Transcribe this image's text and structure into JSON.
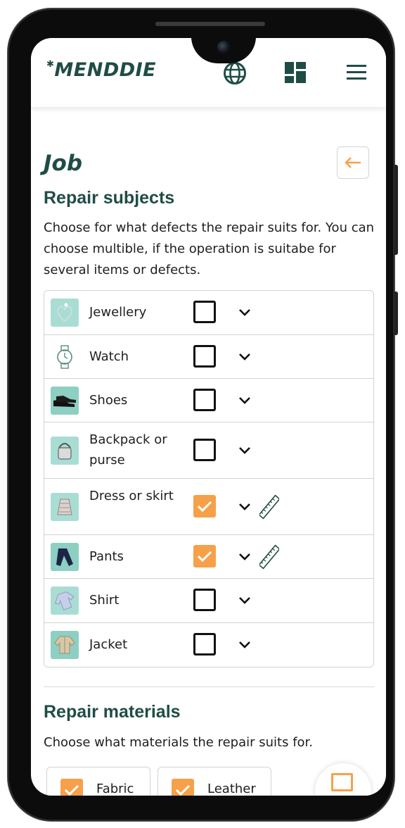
{
  "app": {
    "brand": "MENDDIE"
  },
  "header": {
    "icons": [
      "globe-icon",
      "dashboard-icon",
      "menu-icon"
    ]
  },
  "page": {
    "title": "Job"
  },
  "repair_subjects": {
    "title": "Repair subjects",
    "description": "Choose for what defects the repair suits for. You can choose multible, if the operation is suitabe for several items or defects.",
    "items": [
      {
        "label": "Jewellery",
        "checked": false,
        "has_measure": false
      },
      {
        "label": "Watch",
        "checked": false,
        "has_measure": false
      },
      {
        "label": "Shoes",
        "checked": false,
        "has_measure": false
      },
      {
        "label": "Backpack or purse",
        "checked": false,
        "has_measure": false
      },
      {
        "label": "Dress or skirt",
        "checked": true,
        "has_measure": true
      },
      {
        "label": "Pants",
        "checked": true,
        "has_measure": true
      },
      {
        "label": "Shirt",
        "checked": false,
        "has_measure": false
      },
      {
        "label": "Jacket",
        "checked": false,
        "has_measure": false
      }
    ]
  },
  "repair_materials": {
    "title": "Repair materials",
    "description": "Choose what materials the repair suits for.",
    "items": [
      {
        "label": "Fabric",
        "checked": true
      },
      {
        "label": "Leather",
        "checked": true
      }
    ]
  },
  "colors": {
    "brand": "#1f4d45",
    "accent": "#f7a04a",
    "border": "#d0d4d3"
  }
}
